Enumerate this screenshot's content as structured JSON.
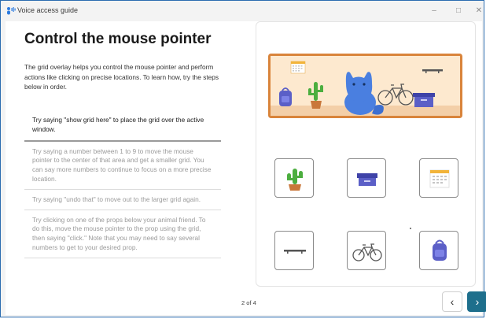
{
  "window": {
    "title": "Voice access guide",
    "controls": {
      "minimize": "–",
      "maximize": "□",
      "close": "✕"
    }
  },
  "main": {
    "title": "Control the mouse pointer",
    "intro": "The grid overlay helps you control the mouse pointer and perform actions like clicking on precise locations. To learn how, try the steps below in order.",
    "steps": [
      {
        "text": "Try saying \"show grid here\" to place the grid over the active window.",
        "active": true
      },
      {
        "text": "Try saying a number between 1 to 9 to move the mouse pointer to the center of that area and get a smaller grid. You can say more numbers to continue to focus on a more precise location.",
        "active": false
      },
      {
        "text": "Try saying \"undo that\" to move out to the larger grid again.",
        "active": false
      },
      {
        "text": "Try clicking on one of the props below your animal friend. To do this, move the mouse pointer to the prop using the grid, then saying \"click.\" Note that you may need to say several numbers to get to your desired prop.",
        "active": false
      }
    ]
  },
  "props": [
    {
      "name": "cactus",
      "icon": "cactus-icon"
    },
    {
      "name": "box",
      "icon": "box-icon"
    },
    {
      "name": "calendar",
      "icon": "calendar-icon"
    },
    {
      "name": "shelf",
      "icon": "shelf-icon"
    },
    {
      "name": "bicycle",
      "icon": "bicycle-icon"
    },
    {
      "name": "backpack",
      "icon": "backpack-icon"
    }
  ],
  "footer": {
    "page_indicator": "2 of 4",
    "prev_icon": "chevron-left-icon",
    "next_icon": "chevron-right-icon"
  },
  "colors": {
    "accent": "#1e6f8c",
    "scene_border": "#d9843b",
    "scene_bg": "#fde9cf",
    "cat_blue": "#4a7fe0",
    "cactus_green": "#4cae3f",
    "box_purple": "#5b5fc7",
    "calendar_yellow": "#f2b43a"
  }
}
